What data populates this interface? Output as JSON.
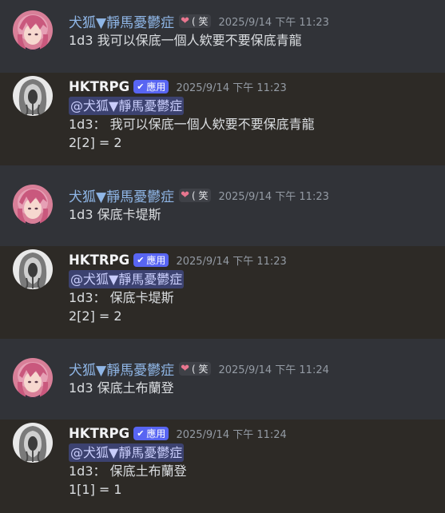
{
  "users": {
    "player": {
      "name": "犬狐▼靜馬憂鬱症",
      "badge_text": "( 笑",
      "avatar_icon": "pink-hair-anime-avatar"
    },
    "bot": {
      "name": "HKTRPG",
      "app_tag": "應用",
      "avatar_icon": "hooded-figure-avatar"
    }
  },
  "messages": [
    {
      "author": "player",
      "timestamp": "2025/9/14 下午 11:23",
      "text": "1d3 我可以保底一個人欸要不要保底青龍"
    },
    {
      "author": "bot",
      "timestamp": "2025/9/14 下午 11:23",
      "mention": "@犬狐▼靜馬憂鬱症",
      "lines": [
        "1d3： 我可以保底一個人欸要不要保底青龍",
        "2[2] = 2"
      ]
    },
    {
      "author": "player",
      "timestamp": "2025/9/14 下午 11:23",
      "text": "1d3 保底卡堤斯"
    },
    {
      "author": "bot",
      "timestamp": "2025/9/14 下午 11:23",
      "mention": "@犬狐▼靜馬憂鬱症",
      "lines": [
        "1d3： 保底卡堤斯",
        "2[2] = 2"
      ]
    },
    {
      "author": "player",
      "timestamp": "2025/9/14 下午 11:24",
      "text": "1d3 保底土布蘭登"
    },
    {
      "author": "bot",
      "timestamp": "2025/9/14 下午 11:24",
      "mention": "@犬狐▼靜馬憂鬱症",
      "lines": [
        "1d3： 保底土布蘭登",
        "1[1] = 1"
      ]
    }
  ]
}
